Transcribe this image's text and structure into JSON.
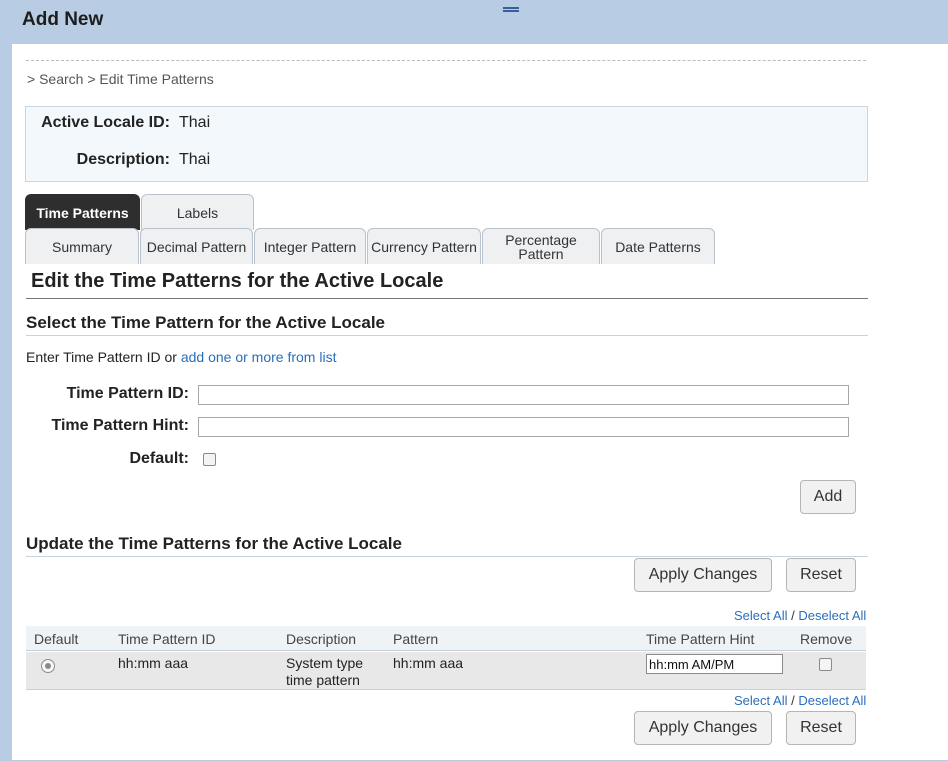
{
  "window": {
    "title": "Add New"
  },
  "breadcrumb": "> Search > Edit Time Patterns",
  "locale": {
    "id_label": "Active Locale ID:",
    "id_value": "Thai",
    "desc_label": "Description:",
    "desc_value": "Thai"
  },
  "tabs": {
    "top": [
      "Time Patterns",
      "Labels"
    ],
    "bottom": [
      "Summary",
      "Decimal Pattern",
      "Integer Pattern",
      "Currency Pattern",
      "Percentage Pattern",
      "Date Patterns"
    ],
    "active": "Time Patterns"
  },
  "main_heading": "Edit the Time Patterns for the Active Locale",
  "select_section": {
    "heading": "Select the Time Pattern for the Active Locale",
    "intro_text": "Enter Time Pattern ID or",
    "intro_link": "add one or more from list",
    "id_label": "Time Pattern ID:",
    "id_value": "",
    "hint_label": "Time Pattern Hint:",
    "hint_value": "",
    "default_label": "Default:",
    "default_checked": false,
    "add_label": "Add"
  },
  "update_section": {
    "heading": "Update the Time Patterns for the Active Locale",
    "apply_label": "Apply Changes",
    "reset_label": "Reset",
    "select_all": "Select All",
    "separator": "/",
    "deselect_all": "Deselect All",
    "columns": [
      "Default",
      "Time Pattern ID",
      "Description",
      "Pattern",
      "Time Pattern Hint",
      "Remove"
    ],
    "rows": [
      {
        "default": true,
        "id": "hh:mm aaa",
        "description": "System type time pattern",
        "pattern": "hh:mm aaa",
        "hint": "hh:mm AM/PM",
        "remove": false
      }
    ]
  },
  "colors": {
    "titlebar": "#b8cde3",
    "active_tab": "#2e2e2e",
    "link": "#2a6ebb",
    "locale_box": "#f2f8fc"
  }
}
